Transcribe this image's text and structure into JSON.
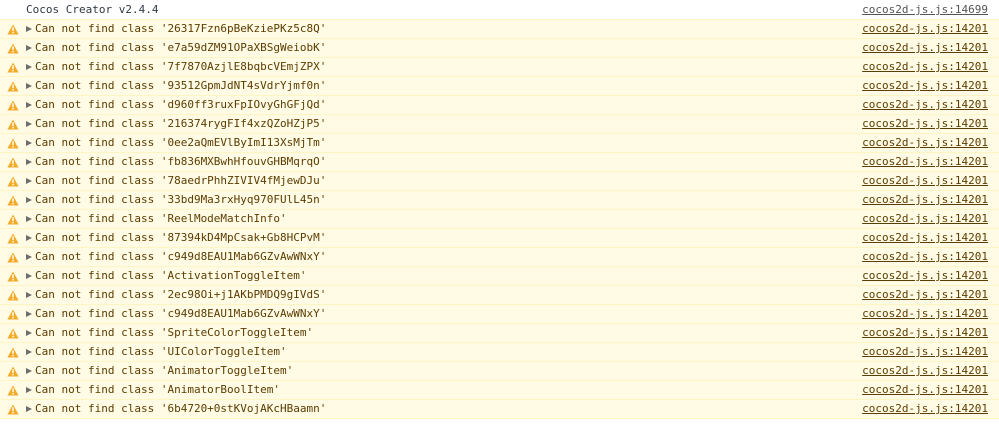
{
  "log": {
    "message": "Cocos Creator v2.4.4",
    "source": "cocos2d-js.js:14699"
  },
  "warnings": [
    {
      "message": "Can not find class '26317Fzn6pBeKziePKz5c8Q'",
      "source": "cocos2d-js.js:14201"
    },
    {
      "message": "Can not find class 'e7a59dZM91OPaXBSgWeiobK'",
      "source": "cocos2d-js.js:14201"
    },
    {
      "message": "Can not find class '7f7870AzjlE8bqbcVEmjZPX'",
      "source": "cocos2d-js.js:14201"
    },
    {
      "message": "Can not find class '93512GpmJdNT4sVdrYjmf0n'",
      "source": "cocos2d-js.js:14201"
    },
    {
      "message": "Can not find class 'd960ff3ruxFpIOvyGhGFjQd'",
      "source": "cocos2d-js.js:14201"
    },
    {
      "message": "Can not find class '216374rygFIf4xzQZoHZjP5'",
      "source": "cocos2d-js.js:14201"
    },
    {
      "message": "Can not find class '0ee2aQmEVlByImI13XsMjTm'",
      "source": "cocos2d-js.js:14201"
    },
    {
      "message": "Can not find class 'fb836MXBwhHfouvGHBMqrqO'",
      "source": "cocos2d-js.js:14201"
    },
    {
      "message": "Can not find class '78aedrPhhZIVIV4fMjewDJu'",
      "source": "cocos2d-js.js:14201"
    },
    {
      "message": "Can not find class '33bd9Ma3rxHyq970FUlL45n'",
      "source": "cocos2d-js.js:14201"
    },
    {
      "message": "Can not find class 'ReelModeMatchInfo'",
      "source": "cocos2d-js.js:14201"
    },
    {
      "message": "Can not find class '87394kD4MpCsak+Gb8HCPvM'",
      "source": "cocos2d-js.js:14201"
    },
    {
      "message": "Can not find class 'c949d8EAU1Mab6GZvAwWNxY'",
      "source": "cocos2d-js.js:14201"
    },
    {
      "message": "Can not find class 'ActivationToggleItem'",
      "source": "cocos2d-js.js:14201"
    },
    {
      "message": "Can not find class '2ec98Oi+j1AKbPMDQ9gIVdS'",
      "source": "cocos2d-js.js:14201"
    },
    {
      "message": "Can not find class 'c949d8EAU1Mab6GZvAwWNxY'",
      "source": "cocos2d-js.js:14201"
    },
    {
      "message": "Can not find class 'SpriteColorToggleItem'",
      "source": "cocos2d-js.js:14201"
    },
    {
      "message": "Can not find class 'UIColorToggleItem'",
      "source": "cocos2d-js.js:14201"
    },
    {
      "message": "Can not find class 'AnimatorToggleItem'",
      "source": "cocos2d-js.js:14201"
    },
    {
      "message": "Can not find class 'AnimatorBoolItem'",
      "source": "cocos2d-js.js:14201"
    },
    {
      "message": "Can not find class '6b4720+0stKVojAKcHBaamn'",
      "source": "cocos2d-js.js:14201"
    }
  ],
  "icons": {
    "warning": "warning-triangle-icon",
    "expand": "expand-arrow-icon"
  },
  "colors": {
    "warning_bg": "#fffbe5",
    "warning_border": "#fff5c2",
    "warning_text": "#5c3c00",
    "warning_icon": "#f2ab26"
  }
}
